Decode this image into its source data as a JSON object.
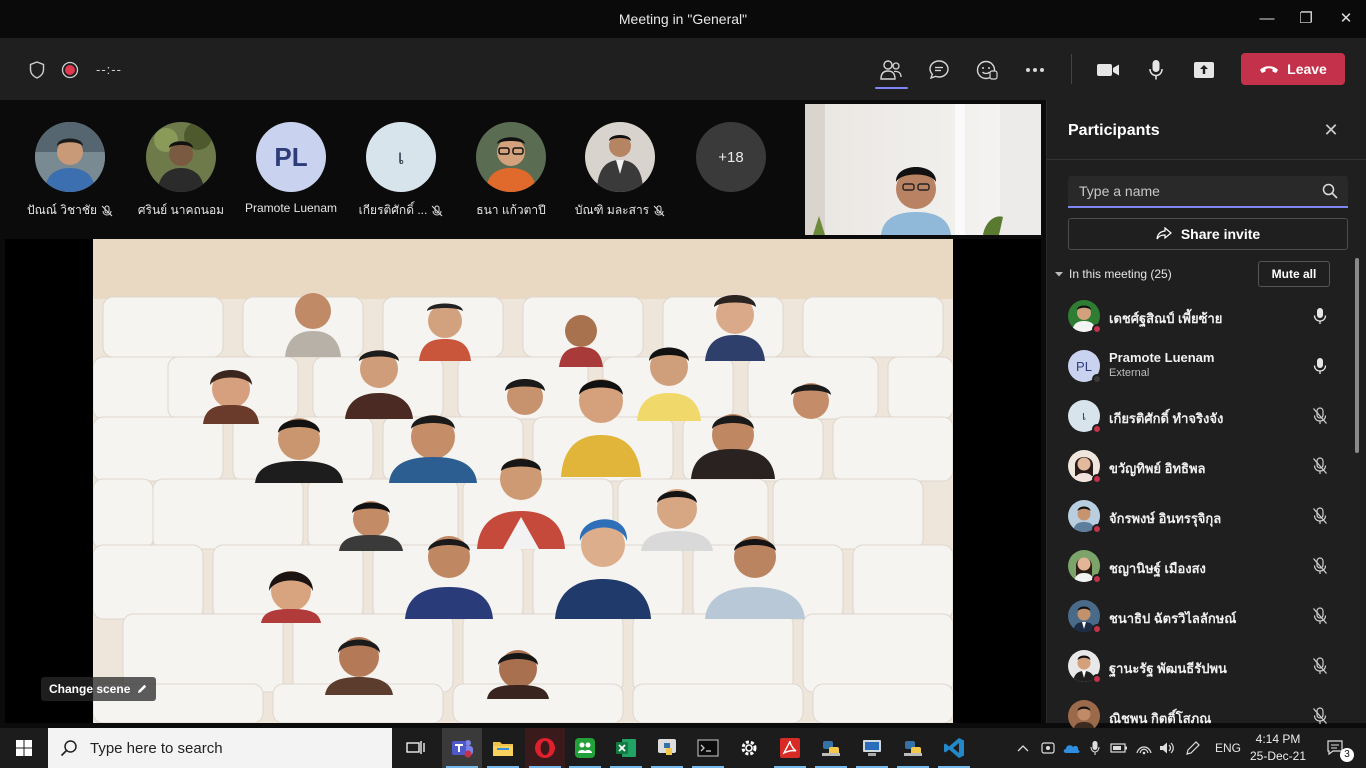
{
  "window": {
    "title": "Meeting in \"General\"",
    "minimize": "—",
    "maximize": "❐",
    "close": "✕"
  },
  "toolbar": {
    "timer": "--:--",
    "leave_label": "Leave"
  },
  "gallery": {
    "participants": [
      {
        "name": "ปัณณ์ วิชาชัย",
        "muted": true,
        "type": "photo",
        "color": "#3b6fb0"
      },
      {
        "name": "ศรินย์ นาคถนอม",
        "muted": false,
        "type": "photo",
        "color": "#5a6b3a"
      },
      {
        "name": "Pramote Luenam",
        "muted": false,
        "type": "initials",
        "initials": "PL",
        "color": "#c9d3ef"
      },
      {
        "name": "เกียรติศักดิ์ ...",
        "muted": true,
        "type": "initials",
        "initials": "เ",
        "color": "#d8e4ec"
      },
      {
        "name": "ธนา แก้วตาปี",
        "muted": false,
        "type": "photo",
        "color": "#e06a2b"
      },
      {
        "name": "บัณฑิ มละสาร",
        "muted": true,
        "type": "photo",
        "color": "#3a3a3a"
      }
    ],
    "more_count": "+18"
  },
  "main_video": {
    "change_scene_label": "Change scene"
  },
  "panel": {
    "title": "Participants",
    "search_placeholder": "Type a name",
    "share_invite_label": "Share invite",
    "in_meeting_label": "In this meeting (25)",
    "mute_all_label": "Mute all",
    "people": [
      {
        "name": "เดชศ์ฐสิณป์ เพี้ยซ้าย",
        "sub": "",
        "mic": "on",
        "type": "photo",
        "color": "#2e7d32"
      },
      {
        "name": "Pramote Luenam",
        "sub": "External",
        "mic": "on",
        "type": "initials",
        "initials": "PL",
        "color": "#c9d3ef"
      },
      {
        "name": "เกียรติศักดิ์ ทำจริงจัง",
        "sub": "",
        "mic": "off",
        "type": "initials",
        "initials": "เ",
        "color": "#d8e4ec"
      },
      {
        "name": "ขวัญทิพย์ อิทธิพล",
        "sub": "",
        "mic": "off",
        "type": "photo",
        "color": "#e8d8cc"
      },
      {
        "name": "จักรพงษ์ อินทรรุจิกุล",
        "sub": "",
        "mic": "off",
        "type": "photo",
        "color": "#8aa8c4"
      },
      {
        "name": "ชญานิษฐ์ เมืองสง",
        "sub": "",
        "mic": "off",
        "type": "photo",
        "color": "#7ca36a"
      },
      {
        "name": "ชนาธิป ฉัตรวิไลลักษณ์",
        "sub": "",
        "mic": "off",
        "type": "photo",
        "color": "#4a6a8a"
      },
      {
        "name": "ฐานะรัฐ พัฒนธีรัปพน",
        "sub": "",
        "mic": "off",
        "type": "photo",
        "color": "#d9d9d9"
      },
      {
        "name": "ณิชพน กิตติ์โสภณ",
        "sub": "",
        "mic": "off",
        "type": "photo",
        "color": "#9b6a4a"
      }
    ]
  },
  "taskbar": {
    "search_placeholder": "Type here to search",
    "language": "ENG",
    "time": "4:14 PM",
    "date": "25-Dec-21",
    "notification_count": "3"
  }
}
